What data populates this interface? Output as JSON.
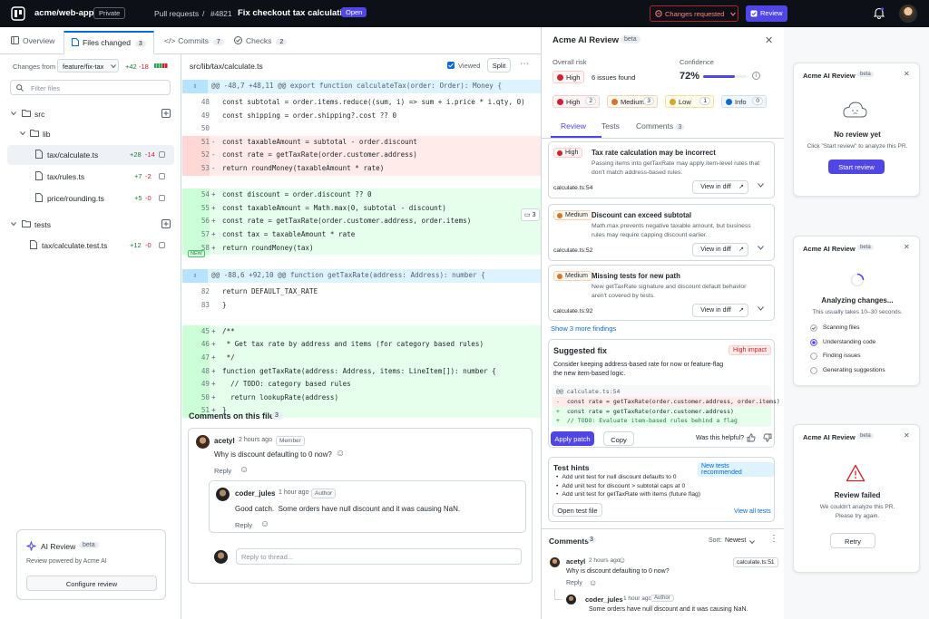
{
  "topbar": {
    "repo": "acme/web-app",
    "visibility": "Private",
    "crumb_pulls": "Pull requests",
    "crumb_sep": "/",
    "pr_number": "#4821",
    "pr_title": "Fix checkout tax calculation",
    "pr_state": "Open",
    "changes_requested": "Changes requested",
    "review_button": "Review"
  },
  "tabs": {
    "overview": "Overview",
    "files_changed": "Files changed",
    "files_changed_count": "3",
    "commits": "Commits",
    "commits_count": "7",
    "checks": "Checks",
    "checks_count": "2"
  },
  "sidebar": {
    "changes_from_label": "Changes from",
    "branch": "feature/fix-tax",
    "total_add": "+42",
    "total_del": "-18",
    "filter_placeholder": "Filter files",
    "tree": [
      {
        "name": "src",
        "type": "folder"
      },
      {
        "name": "lib",
        "type": "folder"
      },
      {
        "name": "tax/calculate.ts",
        "type": "file",
        "add": "+28",
        "del": "-14"
      },
      {
        "name": "tax/rules.ts",
        "type": "file",
        "add": "+7",
        "del": "-2"
      },
      {
        "name": "price/rounding.ts",
        "type": "file",
        "add": "+5",
        "del": "-0"
      },
      {
        "name": "tests",
        "type": "folder"
      },
      {
        "name": "tax/calculate.test.ts",
        "type": "file",
        "add": "+12",
        "del": "-0"
      }
    ],
    "ai_review": {
      "title": "AI Review",
      "badge": "beta",
      "desc": "Review powered by Acme AI",
      "button": "Configure review"
    }
  },
  "diff": {
    "file_path": "src/lib/tax/calculate.ts",
    "viewed_label": "Viewed",
    "split_label": "Split",
    "hunk1": "@@ -48,7 +48,11 @@ export function calculateTax(order: Order): Money {",
    "lines1": [
      {
        "n": "48",
        "s": "",
        "c": "const subtotal = order.items.reduce((sum, i) => sum + i.price * i.qty, 0)",
        "t": "ctx"
      },
      {
        "n": "49",
        "s": "",
        "c": "const shipping = order.shipping?.cost ?? 0",
        "t": "ctx"
      },
      {
        "n": "50",
        "s": "",
        "c": "",
        "t": "ctx"
      },
      {
        "n": "51",
        "s": "-",
        "c": "const taxableAmount = subtotal - order.discount",
        "t": "del"
      },
      {
        "n": "52",
        "s": "-",
        "c": "const rate = getTaxRate(order.customer.address)",
        "t": "del"
      },
      {
        "n": "53",
        "s": "-",
        "c": "return roundMoney(taxableAmount * rate)",
        "t": "del"
      },
      {
        "n": "",
        "s": "",
        "c": "",
        "t": "ctx"
      },
      {
        "n": "54",
        "s": "+",
        "c": "const discount = order.discount ?? 0",
        "t": "add"
      },
      {
        "n": "55",
        "s": "+",
        "c": "const taxableAmount = Math.max(0, subtotal - discount)",
        "t": "add"
      },
      {
        "n": "56",
        "s": "+",
        "c": "const rate = getTaxRate(order.customer.address, order.items)",
        "t": "add"
      },
      {
        "n": "57",
        "s": "+",
        "c": "const tax = taxableAmount * rate",
        "t": "add"
      },
      {
        "n": "58",
        "s": "+",
        "c": "return roundMoney(tax)",
        "t": "add"
      }
    ],
    "new_tag": "NEW",
    "thread_count": "3",
    "hunk2": "@@ -88,6 +92,10 @@ function getTaxRate(address: Address): number {",
    "lines2": [
      {
        "n": "82",
        "s": "",
        "c": "return DEFAULT_TAX_RATE",
        "t": "ctx"
      },
      {
        "n": "83",
        "s": "",
        "c": "}",
        "t": "ctx"
      },
      {
        "n": "",
        "s": "",
        "c": "",
        "t": "ctx"
      },
      {
        "n": "45",
        "s": "+",
        "c": "/**",
        "t": "add"
      },
      {
        "n": "46",
        "s": "+",
        "c": " * Get tax rate by address and items (for category based rules)",
        "t": "add"
      },
      {
        "n": "47",
        "s": "+",
        "c": " */",
        "t": "add"
      },
      {
        "n": "48",
        "s": "+",
        "c": "function getTaxRate(address: Address, items: LineItem[]): number {",
        "t": "add"
      },
      {
        "n": "49",
        "s": "+",
        "c": "  // TODO: category based rules",
        "t": "add"
      },
      {
        "n": "50",
        "s": "+",
        "c": "  return lookupRate(address)",
        "t": "add"
      },
      {
        "n": "51",
        "s": "+",
        "c": "}",
        "t": "add"
      }
    ],
    "comments_title": "Comments on this file",
    "comments_count": "3",
    "c1_user": "acetyl",
    "c1_time": "2 hours ago",
    "c1_role": "Member",
    "c1_text": "Why is discount defaulting to 0 now?",
    "c1_reply": "Reply",
    "c2_user": "coder_jules",
    "c2_time": "1 hour ago",
    "c2_role": "Author",
    "c2_text": "Good catch.  Some orders have null discount and it was causing NaN.",
    "c2_reply": "Reply",
    "reply_placeholder": "Reply to thread..."
  },
  "panel": {
    "title": "Acme AI Review",
    "beta": "beta",
    "overall_risk_label": "Overall risk",
    "risk_level": "High",
    "issues_found": "6 issues found",
    "confidence_label": "Confidence",
    "confidence_value": "72%",
    "confidence_fraction": 0.72,
    "severity": [
      {
        "label": "High",
        "count": "2",
        "color": "#cf222e"
      },
      {
        "label": "Medium",
        "count": "3",
        "color": "#d4762b"
      },
      {
        "label": "Low",
        "count": "1",
        "color": "#d4a72c"
      },
      {
        "label": "Info",
        "count": "0",
        "color": "#0969da"
      }
    ],
    "tab_review": "Review",
    "tab_tests": "Tests",
    "tab_comments": "Comments",
    "tab_comments_count": "3",
    "findings": [
      {
        "sev": "High",
        "title": "Tax rate calculation may be incorrect",
        "desc1": "Passing items into getTaxRate may apply item-level rules that",
        "desc2": "don't match address-based rules.",
        "loc": "calculate.ts:54",
        "btn": "View in diff"
      },
      {
        "sev": "Medium",
        "title": "Discount can exceed subtotal",
        "desc1": "Math.max prevents negative taxable amount, but business",
        "desc2": "rules may require capping discount earlier.",
        "loc": "calculate.ts:52",
        "btn": "View in diff"
      },
      {
        "sev": "Medium",
        "title": "Missing tests for new path",
        "desc1": "New getTaxRate signature and discount default behavior",
        "desc2": "aren't covered by tests.",
        "loc": "calculate.ts:92",
        "btn": "View in diff"
      }
    ],
    "show_more": "Show 3 more findings",
    "fix_title": "Suggested fix",
    "fix_impact": "High impact",
    "fix_desc1": "Consider keeping address-based rate for now or feature-flag",
    "fix_desc2": "the new item-based logic.",
    "fix_hunk": "@@ calculate.ts:54",
    "fix_lines": [
      {
        "s": "-",
        "c": "const rate = getTaxRate(order.customer.address, order.items)",
        "t": "del"
      },
      {
        "s": "+",
        "c": "const rate = getTaxRate(order.customer.address)",
        "t": "add"
      },
      {
        "s": "+",
        "c": "// TODO: Evaluate item-based rules behind a flag",
        "t": "add"
      }
    ],
    "apply_patch": "Apply patch",
    "copy": "Copy",
    "helpful": "Was this helpful?",
    "hints_title": "Test hints",
    "hints_badge": "New tests recommended",
    "hints": [
      "Add unit test for null discount defaults to 0",
      "Add unit test for discount > subtotal caps at 0",
      "Add unit test for getTaxRate with items (future flag)"
    ],
    "open_test": "Open test file",
    "view_all_tests": "View all tests",
    "comments_label": "Comments",
    "comments_count": "3",
    "sort_label": "Sort:",
    "sort_value": "Newest",
    "pc1_user": "acetyl",
    "pc1_time": "2 hours ago",
    "pc1_loc": "calculate.ts:51",
    "pc1_text": "Why is discount defaulting to 0 now?",
    "pc1_reply": "Reply",
    "pc2_user": "coder_jules",
    "pc2_time": "1 hour ago",
    "pc2_role": "Author",
    "pc2_text": "Some orders have null discount and it was causing NaN."
  },
  "states": {
    "s1_title": "Acme AI Review",
    "s1_badge": "beta",
    "s1_heading": "No review yet",
    "s1_desc": "Click \"Start review\" to analyze this PR.",
    "s1_button": "Start review",
    "s2_title": "Acme AI Review",
    "s2_badge": "beta",
    "s2_heading": "Analyzing changes...",
    "s2_desc": "This usually takes 10–30 seconds.",
    "s2_steps": [
      "Scanning files",
      "Understanding code",
      "Finding issues",
      "Generating suggestions"
    ],
    "s3_title": "Acme AI Review",
    "s3_badge": "beta",
    "s3_heading": "Review failed",
    "s3_desc1": "We couldn't analyze this PR.",
    "s3_desc2": "Please try again.",
    "s3_button": "Retry"
  }
}
